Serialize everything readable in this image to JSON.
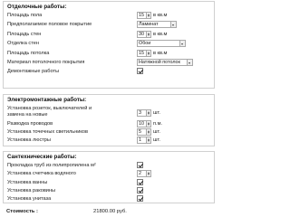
{
  "finishing": {
    "title": "Отделочные работы:",
    "floor_area": {
      "label": "Площадь пола",
      "value": "15",
      "unit": "в кв.м"
    },
    "floor_covering": {
      "label": "Предполагаемое половое покрытие",
      "value": "Ламинат"
    },
    "wall_area": {
      "label": "Площадь стен",
      "value": "30",
      "unit": "в кв.м"
    },
    "wall_finish": {
      "label": "Отделка стен",
      "value": "Обои"
    },
    "ceiling_area": {
      "label": "Площадь потолка",
      "value": "15",
      "unit": "в кв.м"
    },
    "ceiling_material": {
      "label": "Материал потолочного покрытия",
      "value": "Натяжной потолок"
    },
    "dismantling": {
      "label": "Демонтажные работы",
      "checked": true
    }
  },
  "electrical": {
    "title": "Электромонтажные работы:",
    "sockets": {
      "label_line1": "Установка розеток, выключателей и",
      "label_line2": "замена на новые",
      "value": "3",
      "unit": "шт."
    },
    "wiring": {
      "label": "Разводка проводов",
      "value": "10",
      "unit": "п.м."
    },
    "spotlights": {
      "label": "Установка точечных светильников",
      "value": "5",
      "unit": "шт."
    },
    "chandelier": {
      "label": "Установка люстры",
      "value": "1",
      "unit": "шт."
    }
  },
  "plumbing": {
    "title": "Сантехнические работы:",
    "pipes": {
      "label": "Прокладка труб из полипропилена м²",
      "checked": true
    },
    "water_meter": {
      "label": "Установка счетчика водяного",
      "value": "2"
    },
    "bath": {
      "label": "Установка ванны",
      "checked": true
    },
    "sink": {
      "label": "Установка раковины",
      "checked": true
    },
    "toilet": {
      "label": "Установка унитаза",
      "checked": true
    }
  },
  "total": {
    "label": "Стоимость :",
    "value": "21800.00 руб."
  }
}
